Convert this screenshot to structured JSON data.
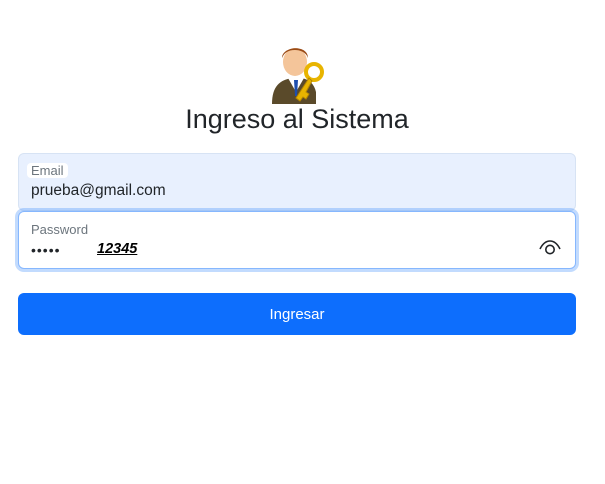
{
  "header": {
    "title": "Ingreso al Sistema",
    "logo_icon": "user-key-icon"
  },
  "form": {
    "email": {
      "label": "Email",
      "value": "prueba@gmail.com"
    },
    "password": {
      "label": "Password",
      "masked_value": "•••••",
      "revealed_value": "12345",
      "toggle_icon": "eye-icon"
    },
    "submit_label": "Ingresar"
  },
  "colors": {
    "primary": "#0d6efd",
    "autofill_bg": "#e8f0fe",
    "focus_border": "#86b7fe"
  }
}
